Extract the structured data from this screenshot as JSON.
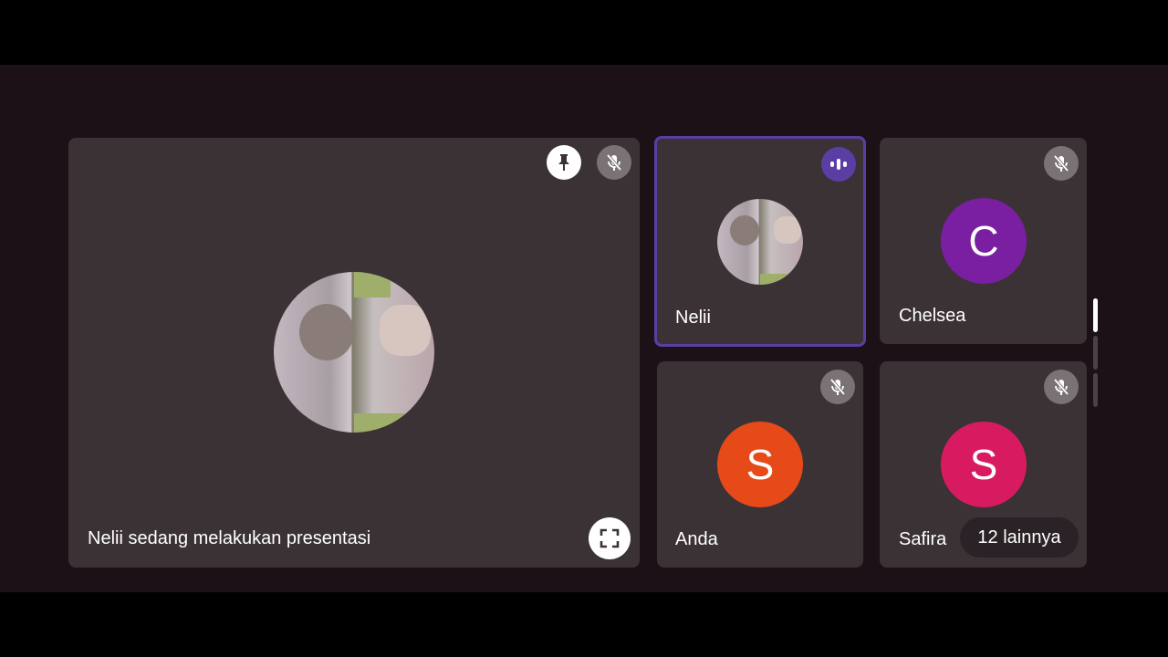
{
  "presentation": {
    "caption": "Nelii sedang melakukan presentasi",
    "pin_icon": "pin-icon",
    "mic_icon": "mic-off-icon",
    "fullscreen_icon": "fullscreen-icon"
  },
  "participants": [
    {
      "name": "Nelii",
      "state": "speaking",
      "avatar": "photo"
    },
    {
      "name": "Chelsea",
      "state": "muted",
      "initial": "C",
      "color": "#7b1fa2"
    },
    {
      "name": "Anda",
      "state": "muted",
      "initial": "S",
      "color": "#e64a19"
    },
    {
      "name": "Safira",
      "state": "muted",
      "initial": "S",
      "color": "#d81b60"
    }
  ],
  "more": {
    "label": "12 lainnya"
  },
  "colors": {
    "tile": "#3b3236",
    "background": "#1c1117",
    "speaking_border": "#5b3ea4"
  }
}
